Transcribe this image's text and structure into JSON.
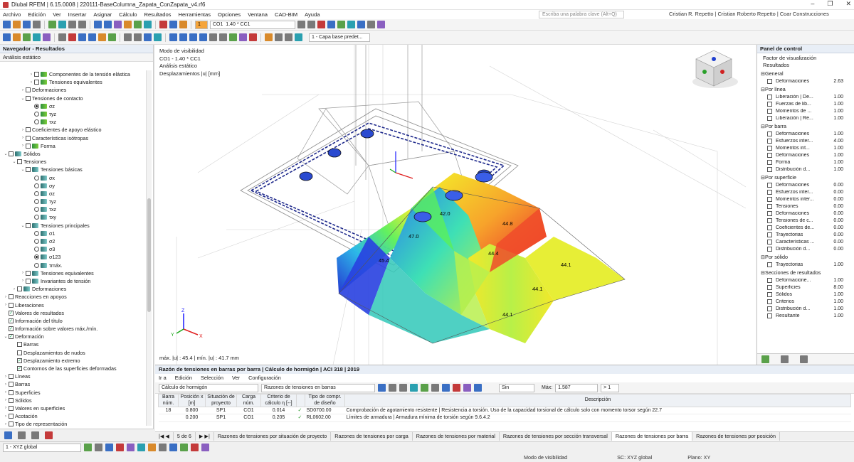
{
  "window": {
    "title": "Dlubal RFEM | 6.15.0008 | 220111-BaseColumna_Zapata_ConZapata_v4.rf6",
    "controls": [
      "–",
      "❐",
      "✕"
    ]
  },
  "menu": {
    "items": [
      "Archivo",
      "Edición",
      "Ver",
      "Insertar",
      "Asignar",
      "Cálculo",
      "Resultados",
      "Herramientas",
      "Opciones",
      "Ventana",
      "CAD-BIM",
      "Ayuda"
    ],
    "search_placeholder": "Escriba una palabra clave (Alt+Q)",
    "user": "Cristian R. Repetto | Cristian Roberto Repetto | Coar Construcciones"
  },
  "toolbar": {
    "load_case_num": "1",
    "load_case_id": "CO1",
    "load_case_name": "1.40 * CC1",
    "layer": "1 - Capa base predet..."
  },
  "navigator": {
    "title": "Navegador - Resultados",
    "subheader": "Análisis estático",
    "tree": [
      {
        "label": "Componentes de la tensión elástica",
        "indent": 3,
        "type": "cb",
        "icon": "g",
        "tw": "›"
      },
      {
        "label": "Tensiones equivalentes",
        "indent": 3,
        "type": "cb",
        "icon": "g",
        "tw": "›"
      },
      {
        "label": "Deformaciones",
        "indent": 2,
        "type": "cb",
        "icon": "",
        "tw": "›"
      },
      {
        "label": "Tensiones de contacto",
        "indent": 2,
        "type": "cb",
        "icon": "",
        "tw": "⌄"
      },
      {
        "label": "σz",
        "indent": 3,
        "type": "rd",
        "on": true,
        "icon": "g"
      },
      {
        "label": "τyz",
        "indent": 3,
        "type": "rd",
        "icon": "g"
      },
      {
        "label": "τxz",
        "indent": 3,
        "type": "rd",
        "icon": "g"
      },
      {
        "label": "Coeficientes de apoyo elástico",
        "indent": 2,
        "type": "cb",
        "icon": "",
        "tw": "›"
      },
      {
        "label": "Características isótropas",
        "indent": 2,
        "type": "cb",
        "icon": "",
        "tw": "›"
      },
      {
        "label": "Forma",
        "indent": 2,
        "type": "cb",
        "icon": "g",
        "tw": "›"
      },
      {
        "label": "Sólidos",
        "indent": 0,
        "type": "cb",
        "icon": "t",
        "tw": "⌄"
      },
      {
        "label": "Tensiones",
        "indent": 1,
        "type": "cb",
        "icon": "",
        "tw": "⌄"
      },
      {
        "label": "Tensiones básicas",
        "indent": 2,
        "type": "cb",
        "icon": "t",
        "tw": "⌄"
      },
      {
        "label": "σx",
        "indent": 3,
        "type": "rd",
        "icon": "t"
      },
      {
        "label": "σy",
        "indent": 3,
        "type": "rd",
        "icon": "t"
      },
      {
        "label": "σz",
        "indent": 3,
        "type": "rd",
        "icon": "t"
      },
      {
        "label": "τyz",
        "indent": 3,
        "type": "rd",
        "icon": "t"
      },
      {
        "label": "τxz",
        "indent": 3,
        "type": "rd",
        "icon": "t"
      },
      {
        "label": "τxy",
        "indent": 3,
        "type": "rd",
        "icon": "t"
      },
      {
        "label": "Tensiones principales",
        "indent": 2,
        "type": "cb",
        "icon": "t",
        "tw": "⌄"
      },
      {
        "label": "σ1",
        "indent": 3,
        "type": "rd",
        "icon": "t"
      },
      {
        "label": "σ2",
        "indent": 3,
        "type": "rd",
        "icon": "t"
      },
      {
        "label": "σ3",
        "indent": 3,
        "type": "rd",
        "icon": "t"
      },
      {
        "label": "σ123",
        "indent": 3,
        "type": "rd",
        "on": true,
        "icon": "t"
      },
      {
        "label": "τmáx.",
        "indent": 3,
        "type": "rd",
        "icon": "t"
      },
      {
        "label": "Tensiones equivalentes",
        "indent": 2,
        "type": "cb",
        "icon": "t",
        "tw": "›"
      },
      {
        "label": "Invariantes de tensión",
        "indent": 2,
        "type": "cb",
        "icon": "t",
        "tw": "›"
      },
      {
        "label": "Deformaciones",
        "indent": 1,
        "type": "cb",
        "icon": "t",
        "tw": "›"
      },
      {
        "label": "Reacciones en apoyos",
        "indent": 0,
        "type": "cb",
        "icon": "",
        "tw": "›"
      },
      {
        "label": "Liberaciones",
        "indent": 0,
        "type": "cb",
        "icon": "",
        "tw": "›"
      },
      {
        "label": "Valores de resultados",
        "indent": 0,
        "type": "cb",
        "chk": true,
        "icon": "",
        "tw": ""
      },
      {
        "label": "Información del título",
        "indent": 0,
        "type": "cb",
        "chk": true,
        "icon": "",
        "tw": ""
      },
      {
        "label": "Información sobre valores máx./mín.",
        "indent": 0,
        "type": "cb",
        "chk": true,
        "icon": "",
        "tw": ""
      },
      {
        "label": "Deformación",
        "indent": 0,
        "type": "cb",
        "chk": true,
        "icon": "",
        "tw": "⌄"
      },
      {
        "label": "Barras",
        "indent": 1,
        "type": "cb",
        "icon": "",
        "tw": ""
      },
      {
        "label": "Desplazamientos de nudos",
        "indent": 1,
        "type": "cb",
        "icon": "",
        "tw": ""
      },
      {
        "label": "Desplazamiento extremo",
        "indent": 1,
        "type": "cb",
        "chk": true,
        "icon": "",
        "tw": ""
      },
      {
        "label": "Contornos de las superficies deformadas",
        "indent": 1,
        "type": "cb",
        "chk": true,
        "icon": "",
        "tw": ""
      },
      {
        "label": "Líneas",
        "indent": 0,
        "type": "cb",
        "icon": "",
        "tw": "›"
      },
      {
        "label": "Barras",
        "indent": 0,
        "type": "cb",
        "icon": "",
        "tw": "›"
      },
      {
        "label": "Superficies",
        "indent": 0,
        "type": "cb",
        "icon": "",
        "tw": "›"
      },
      {
        "label": "Sólidos",
        "indent": 0,
        "type": "cb",
        "icon": "",
        "tw": "›"
      },
      {
        "label": "Valores en superficies",
        "indent": 0,
        "type": "cb",
        "icon": "",
        "tw": "›"
      },
      {
        "label": "Acotación",
        "indent": 0,
        "type": "cb",
        "icon": "",
        "tw": "›"
      },
      {
        "label": "Tipo de representación",
        "indent": 0,
        "type": "cb",
        "icon": "",
        "tw": "›"
      }
    ]
  },
  "viewport": {
    "info": [
      "Modo de visibilidad",
      "CO1 - 1.40 * CC1",
      "Análisis estático",
      "Desplazamientos |u| [mm]"
    ],
    "footer": "máx. |u| : 45.4 | mín. |u| : 41.7 mm",
    "labels": [
      "42.0",
      "47.0",
      "44.8",
      "44.4",
      "44.1",
      "44.1",
      "44.1",
      "45.4"
    ]
  },
  "control": {
    "title": "Panel de control",
    "subtitle1": "Factor de visualización",
    "subtitle2": "Resultados",
    "groups": [
      {
        "name": "General",
        "rows": [
          [
            "Deformaciones",
            "2.63"
          ]
        ]
      },
      {
        "name": "Por línea",
        "rows": [
          [
            "Liberación | De...",
            "1.00"
          ],
          [
            "Fuerzas de lib...",
            "1.00"
          ],
          [
            "Momentos de ...",
            "1.00"
          ],
          [
            "Liberación | Re...",
            "1.00"
          ]
        ]
      },
      {
        "name": "Por barra",
        "rows": [
          [
            "Deformaciones",
            "1.00"
          ],
          [
            "Esfuerzos inter...",
            "4.00"
          ],
          [
            "Momentos int...",
            "1.00"
          ],
          [
            "Deformaciones",
            "1.00"
          ],
          [
            "Forma",
            "1.00"
          ],
          [
            "Distribución d...",
            "1.00"
          ]
        ]
      },
      {
        "name": "Por superficie",
        "rows": [
          [
            "Deformaciones",
            "0.00"
          ],
          [
            "Esfuerzos inter...",
            "0.00"
          ],
          [
            "Momentos inter...",
            "0.00"
          ],
          [
            "Tensiones",
            "0.00"
          ],
          [
            "Deformaciones",
            "0.00"
          ],
          [
            "Tensiones de c...",
            "0.00"
          ],
          [
            "Coeficientes de...",
            "0.00"
          ],
          [
            "Trayectorias",
            "0.00"
          ],
          [
            "Características ...",
            "0.00"
          ],
          [
            "Distribución d...",
            "0.00"
          ]
        ]
      },
      {
        "name": "Por sólido",
        "rows": [
          [
            "Trayectorias",
            "1.00"
          ]
        ]
      },
      {
        "name": "Secciones de resultados",
        "rows": [
          [
            "Deformacione...",
            "1.00"
          ],
          [
            "Superficies",
            "8.00"
          ],
          [
            "Sólidos",
            "1.00"
          ],
          [
            "Criterios",
            "1.00"
          ],
          [
            "Distribución d...",
            "1.00"
          ],
          [
            "Resultante",
            "1.00"
          ]
        ]
      }
    ]
  },
  "bottom": {
    "title": "Razón de tensiones en barras por barra | Cálculo de hormigón | ACI 318 | 2019",
    "menu": [
      "Ir a",
      "Edición",
      "Selección",
      "Ver",
      "Configuración"
    ],
    "dd1": "Cálculo de hormigón",
    "dd2": "Razones de tensiones en barras",
    "filter": "Sin",
    "max_label": "Máx:",
    "max_value": "1.587",
    "gt": "> 1",
    "headers": [
      "Barra núm.",
      "Posición x [m]",
      "Situación de proyecto",
      "Carga núm.",
      "Criterio de cálculo η [--]",
      "",
      "Tipo de compr. de diseño",
      "Descripción"
    ],
    "rows": [
      [
        "18",
        "0.800",
        "SP1",
        "CO1",
        "0.014",
        "✓",
        "SD0700.00",
        "Comprobación de agotamiento resistente | Resistencia a torsión. Uso de la capacidad torsional de cálculo solo con momento torsor según 22.7"
      ],
      [
        "",
        "0.200",
        "SP1",
        "CO1",
        "0.205",
        "✓",
        "RL0602.00",
        "Límites de armadura | Armadura mínima de torsión según 9.6.4.2"
      ]
    ],
    "pager": "5 de 6",
    "tabs": [
      "Razones de tensiones por situación de proyecto",
      "Razones de tensiones por carga",
      "Razones de tensiones por material",
      "Razones de tensiones por sección transversal",
      "Razones de tensiones por barra",
      "Razones de tensiones por posición"
    ]
  },
  "status": {
    "dd": "1 - XYZ global",
    "visibility": "Modo de visibilidad",
    "cs": "SC: XYZ global",
    "plane": "Plano: XY"
  }
}
